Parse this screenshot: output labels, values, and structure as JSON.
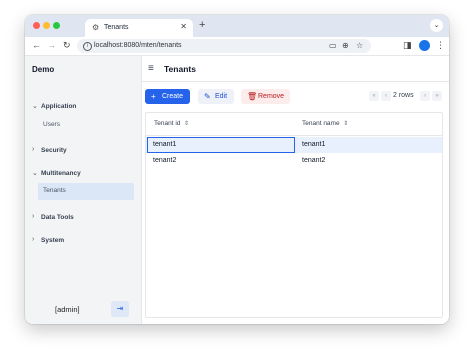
{
  "browser": {
    "tab_title": "Tenants",
    "new_tab_icon": "+",
    "url": "localhost:8080/mten/tenants"
  },
  "sidebar": {
    "brand": "Demo",
    "sections": [
      {
        "label": "Application",
        "expanded": true,
        "items": [
          "Users"
        ]
      },
      {
        "label": "Security",
        "expanded": false,
        "items": []
      },
      {
        "label": "Multitenancy",
        "expanded": true,
        "items": [
          "Tenants"
        ]
      },
      {
        "label": "Data Tools",
        "expanded": false,
        "items": []
      },
      {
        "label": "System",
        "expanded": false,
        "items": []
      }
    ],
    "active_item": "Tenants",
    "user": "[admin]"
  },
  "main": {
    "title": "Tenants",
    "toolbar": {
      "create_label": "Create",
      "edit_label": "Edit",
      "remove_label": "Remove"
    },
    "pagination": {
      "rows_text": "2 rows"
    },
    "table": {
      "columns": [
        "Tenant id",
        "Tenant name"
      ],
      "rows": [
        [
          "tenant1",
          "tenant1"
        ],
        [
          "tenant2",
          "tenant2"
        ]
      ],
      "selected_row": 0
    }
  },
  "colors": {
    "accent": "#2563eb",
    "remove": "#b91c1c",
    "sidebar_bg": "#f3f4f6",
    "selected_row_bg": "#e8f0fd"
  },
  "icons": [
    "tab-favicon",
    "close-tab-icon",
    "back-icon",
    "forward-icon",
    "reload-icon",
    "site-info-icon",
    "cast-icon",
    "zoom-icon",
    "bookmark-star-icon",
    "sidepanel-icon",
    "profile-icon",
    "menu-kebab-icon",
    "hamburger-icon",
    "plus-icon",
    "pencil-icon",
    "trash-icon",
    "logout-icon",
    "sort-icon"
  ]
}
